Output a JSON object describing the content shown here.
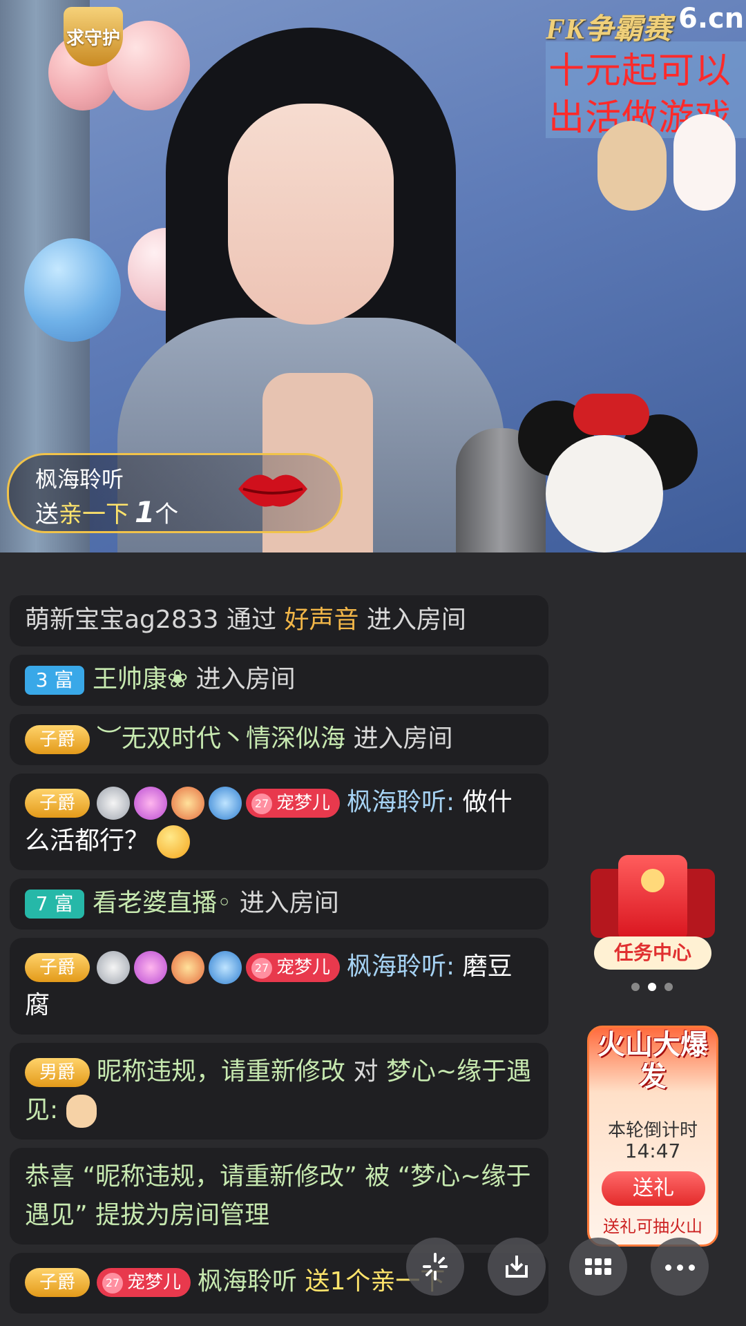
{
  "stream": {
    "guard_badge": "求守护",
    "event_logo": "FK争霸赛",
    "site_logo": "6.cn",
    "promo_line1": "十元起可以",
    "promo_line2": "出活做游戏"
  },
  "gift_toast": {
    "user": "枫海聆听",
    "prefix": "送",
    "gift": "亲一下",
    "count": "1",
    "unit": "个"
  },
  "chat": {
    "m1": {
      "user": "萌新宝宝ag2833",
      "via": "通过",
      "source": "好声音",
      "action": "进入房间"
    },
    "m2": {
      "level": "3 富",
      "user": "王帅康❀",
      "action": "进入房间"
    },
    "m3": {
      "rank": "子爵",
      "user": "︶无双时代丶情深似海",
      "action": "进入房间"
    },
    "m4": {
      "rank": "子爵",
      "pet_num": "27",
      "pet": "宠梦儿",
      "user": "枫海聆听:",
      "text": "做什么活都行？"
    },
    "m5": {
      "level": "7 富",
      "user": "看老婆直播◦",
      "action": "进入房间"
    },
    "m6": {
      "rank": "子爵",
      "pet_num": "27",
      "pet": "宠梦儿",
      "user": "枫海聆听:",
      "text": "磨豆腐"
    },
    "m7": {
      "rank": "男爵",
      "user": "昵称违规，请重新修改",
      "to": "对",
      "target": "梦心~缘于遇见:"
    },
    "m8": {
      "text": "恭喜 “昵称违规，请重新修改” 被 “梦心~缘于遇见” 提拔为房间管理"
    },
    "m9": {
      "rank": "子爵",
      "pet_num": "27",
      "pet": "宠梦儿",
      "user": "枫海聆听",
      "text": "送1个亲一下"
    }
  },
  "task_center": {
    "label": "任务中心"
  },
  "volcano": {
    "title": "火山大爆发",
    "countdown_label": "本轮倒计时",
    "countdown": "14:47",
    "send_label": "送礼",
    "note": "送礼可抽火山"
  },
  "colors": {
    "rank_gold": "#f2b648",
    "level_blue": "#39a8e8",
    "level_teal": "#26b8a8",
    "pet_red": "#e8394d"
  }
}
